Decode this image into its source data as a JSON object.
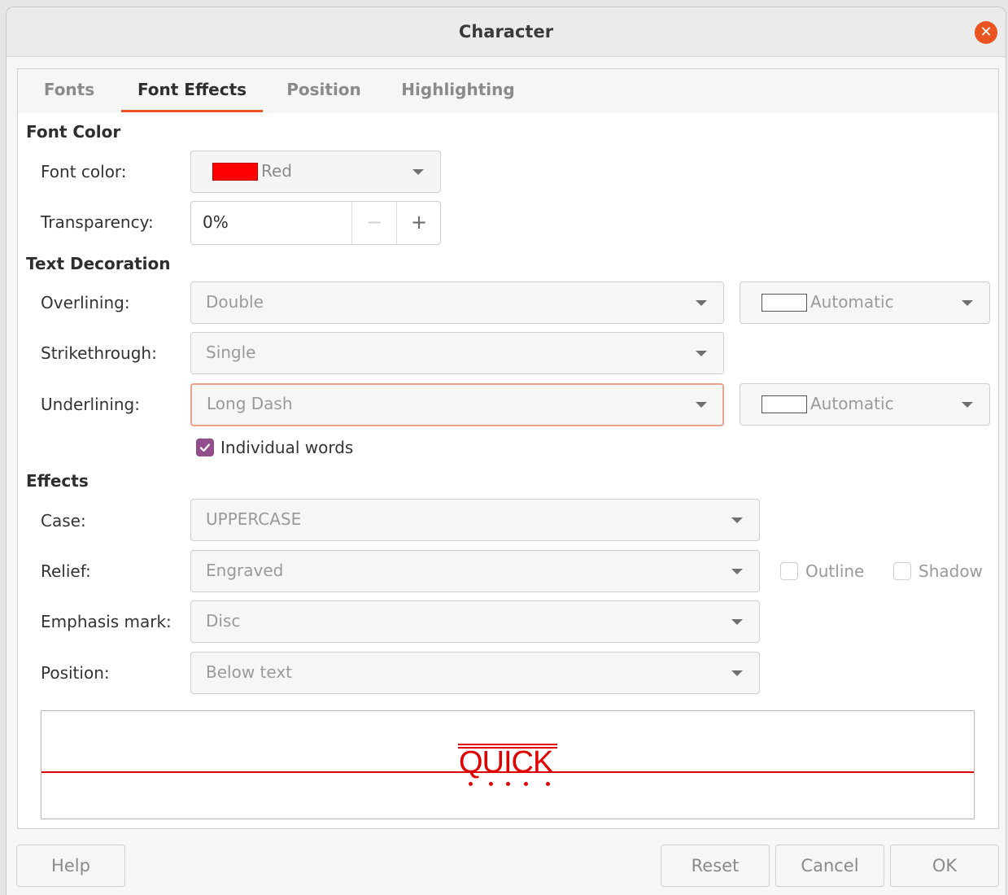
{
  "window": {
    "title": "Character"
  },
  "tabs": [
    {
      "label": "Fonts"
    },
    {
      "label": "Font Effects",
      "active": true
    },
    {
      "label": "Position"
    },
    {
      "label": "Highlighting"
    }
  ],
  "font_color": {
    "heading": "Font Color",
    "color_label": "Font color:",
    "color_value": "Red",
    "color_swatch": "#ff0000",
    "transparency_label": "Transparency:",
    "transparency_value": "0%"
  },
  "text_decoration": {
    "heading": "Text Decoration",
    "overlining_label": "Overlining:",
    "overlining_value": "Double",
    "overlining_color": "Automatic",
    "strikethrough_label": "Strikethrough:",
    "strikethrough_value": "Single",
    "underlining_label": "Underlining:",
    "underlining_value": "Long Dash",
    "underlining_color": "Automatic",
    "individual_words_label": "Individual words",
    "individual_words_checked": true
  },
  "effects": {
    "heading": "Effects",
    "case_label": "Case:",
    "case_value": "UPPERCASE",
    "relief_label": "Relief:",
    "relief_value": "Engraved",
    "outline_label": "Outline",
    "shadow_label": "Shadow",
    "emphasis_label": "Emphasis mark:",
    "emphasis_value": "Disc",
    "position_label": "Position:",
    "position_value": "Below text"
  },
  "preview": {
    "text": "QUICK",
    "color": "#e00000"
  },
  "buttons": {
    "help": "Help",
    "reset": "Reset",
    "cancel": "Cancel",
    "ok": "OK"
  },
  "accent_color": "#e95420",
  "checkbox_color": "#924d8b"
}
